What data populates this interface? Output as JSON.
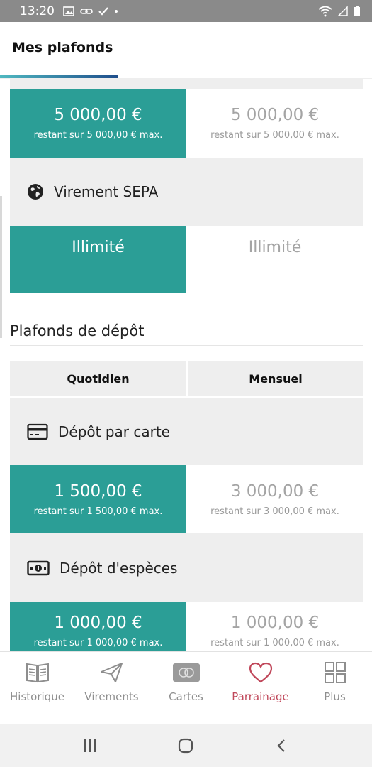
{
  "status_bar": {
    "time": "13:20"
  },
  "header": {
    "title": "Mes plafonds"
  },
  "transfers": {
    "top_row": {
      "daily": {
        "amount": "5 000,00 €",
        "remaining": "restant sur 5 000,00 € max."
      },
      "monthly": {
        "amount": "5 000,00 €",
        "remaining": "restant sur 5 000,00 € max."
      }
    },
    "sepa": {
      "label": "Virement SEPA",
      "icon": "globe-icon",
      "daily": "Illimité",
      "monthly": "Illimité"
    }
  },
  "deposit_section": {
    "title": "Plafonds de dépôt",
    "columns": [
      "Quotidien",
      "Mensuel"
    ],
    "rows": [
      {
        "label": "Dépôt par carte",
        "icon": "credit-card-icon",
        "daily": {
          "amount": "1 500,00 €",
          "remaining": "restant sur 1 500,00 € max."
        },
        "monthly": {
          "amount": "3 000,00 €",
          "remaining": "restant sur 3 000,00 € max."
        }
      },
      {
        "label": "Dépôt d'espèces",
        "icon": "banknote-icon",
        "daily": {
          "amount": "1 000,00 €",
          "remaining": "restant sur 1 000,00 € max."
        },
        "monthly": {
          "amount": "1 000,00 €",
          "remaining": "restant sur 1 000,00 € max."
        }
      }
    ]
  },
  "bottom_nav": {
    "items": [
      {
        "label": "Historique",
        "icon": "book-icon"
      },
      {
        "label": "Virements",
        "icon": "paper-plane-icon"
      },
      {
        "label": "Cartes",
        "icon": "card-icon"
      },
      {
        "label": "Parrainage",
        "icon": "heart-icon",
        "active": true
      },
      {
        "label": "Plus",
        "icon": "grid-icon"
      }
    ]
  },
  "colors": {
    "teal": "#2b9e96",
    "active_nav": "#c0475a",
    "grey_bg": "#eeeeee"
  }
}
